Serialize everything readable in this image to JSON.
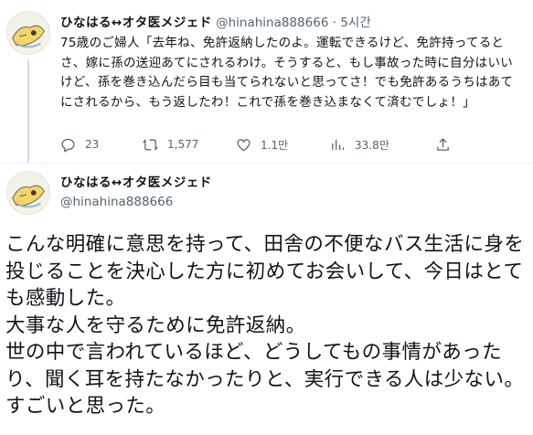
{
  "tweet1": {
    "display_name": "ひなはる↔オタ医メジェド",
    "handle": "@hinahina888666",
    "separator": "·",
    "time": "5시간",
    "text": "75歳のご婦人「去年ね、免許返納したのよ。運転できるけど、免許持ってるとさ、嫁に孫の送迎あてにされるわけ。そうすると、もし事故った時に自分はいいけど、孫を巻き込んだら目も当てられないと思ってさ！でも免許あるうちはあてにされるから、もう返したわ！これで孫を巻き込まなくて済むでしょ！」",
    "actions": {
      "reply_count": "23",
      "retweet_count": "1,577",
      "like_count": "1.1만",
      "view_count": "33.8만"
    },
    "icons": {
      "reply": "reply-icon",
      "retweet": "retweet-icon",
      "like": "heart-icon",
      "views": "views-icon",
      "share": "share-icon"
    }
  },
  "tweet2": {
    "display_name": "ひなはる↔オタ医メジェド",
    "handle": "@hinahina888666",
    "text": "こんな明確に意思を持って、田舎の不便なバス生活に身を投じることを決心した方に初めてお会いして、今日はとても感動した。\n大事な人を守るために免許返納。\n世の中で言われているほど、どうしてもの事情があったり、聞く耳を持たなかったりと、実行できる人は少ない。\nすごいと思った。"
  },
  "colors": {
    "text": "#0f1419",
    "secondary": "#536471",
    "divider": "#eff3f4"
  }
}
